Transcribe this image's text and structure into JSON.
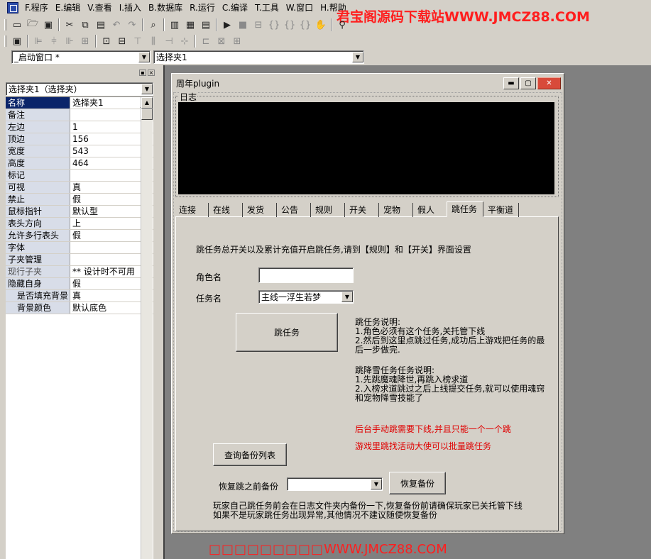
{
  "menubar": {
    "items": [
      "F.程序",
      "E.编辑",
      "V.查看",
      "I.插入",
      "B.数据库",
      "R.运行",
      "C.编译",
      "T.工具",
      "W.窗口",
      "H.帮助"
    ]
  },
  "watermark": {
    "top": "君宝阁源码下载站WWW.JMCZ88.COM",
    "bottom_boxes": "□□□□□□□□□",
    "bottom_url": "WWW.JMCZ88.COM"
  },
  "toolbar1": [
    "new-file-icon",
    "open-folder-icon",
    "save-icon",
    "cut-icon",
    "copy-icon",
    "paste-icon",
    "undo-icon",
    "redo-icon",
    "find-icon",
    "layout-1-icon",
    "layout-2-icon",
    "layout-3-icon",
    "run-icon",
    "stop-icon",
    "step-icon",
    "step-into-icon",
    "step-over-icon",
    "step-out-icon",
    "hand-icon",
    "binoculars-icon"
  ],
  "toolbar2": [
    "properties-icon",
    "align-left-icon",
    "align-center-icon",
    "align-right-icon",
    "align-grid-icon",
    "same-size-icon",
    "center-form-icon",
    "align-top-icon",
    "space-horiz-icon",
    "space-vert-icon",
    "stretch-h-icon",
    "stretch-v-icon",
    "stretch-both-icon"
  ],
  "combos": {
    "window_select": "_启动窗口 *",
    "component_select": "选择夹1"
  },
  "prop_panel": {
    "selector": "选择夹1（选择夹）",
    "rows": [
      {
        "name": "名称",
        "value": "选择夹1",
        "selected": true
      },
      {
        "name": "备注",
        "value": ""
      },
      {
        "name": "左边",
        "value": "1"
      },
      {
        "name": "顶边",
        "value": "156"
      },
      {
        "name": "宽度",
        "value": "543"
      },
      {
        "name": "高度",
        "value": "464"
      },
      {
        "name": "标记",
        "value": ""
      },
      {
        "name": "可视",
        "value": "真"
      },
      {
        "name": "禁止",
        "value": "假"
      },
      {
        "name": "鼠标指针",
        "value": "默认型"
      },
      {
        "name": "表头方向",
        "value": "上"
      },
      {
        "name": "允许多行表头",
        "value": "假"
      },
      {
        "name": "字体",
        "value": ""
      },
      {
        "name": "子夹管理",
        "value": ""
      },
      {
        "name": "现行子夹",
        "value": "** 设计时不可用",
        "gray": true
      },
      {
        "name": "隐藏自身",
        "value": "假"
      },
      {
        "name": "是否填充背景",
        "value": "真",
        "indent": true
      },
      {
        "name": "背景颜色",
        "value": "默认底色",
        "indent": true
      }
    ]
  },
  "form": {
    "title": "周年plugin",
    "log_label": "日志",
    "tabs": [
      "连接",
      "在线",
      "发货",
      "公告",
      "规则",
      "开关",
      "宠物",
      "假人",
      "跳任务",
      "平衡道"
    ],
    "active_tab": 8,
    "page": {
      "intro": "跳任务总开关以及累计充值开启跳任务,请到【规则】和【开关】界面设置",
      "role_label": "角色名",
      "role_value": "",
      "task_label": "任务名",
      "task_value": "主线一浮生若梦",
      "jump_button": "跳任务",
      "note1": "跳任务说明:\n1.角色必须有这个任务,关托管下线\n2.然后到这里点跳过任务,成功后上游戏把任务的最\n后一步做完.",
      "note2": "跳降雪任务任务说明:\n1.先跳魔魂降世,再跳入榜求道\n2.入榜求道跳过之后上线提交任务,就可以使用魂窍\n和宠物降雪技能了",
      "red1": "后台手动跳需要下线,并且只能一个一个跳",
      "red2": "游戏里跳找活动大使可以批量跳任务",
      "query_button": "查询备份列表",
      "restore_label": "恢复跳之前备份",
      "restore_value": "",
      "restore_button": "恢复备份",
      "footer": "玩家自己跳任务前会在日志文件夹内备份一下,恢复备份前请确保玩家已关托管下线\n如果不是玩家跳任务出现异常,其他情况不建议随便恢复备份"
    }
  }
}
